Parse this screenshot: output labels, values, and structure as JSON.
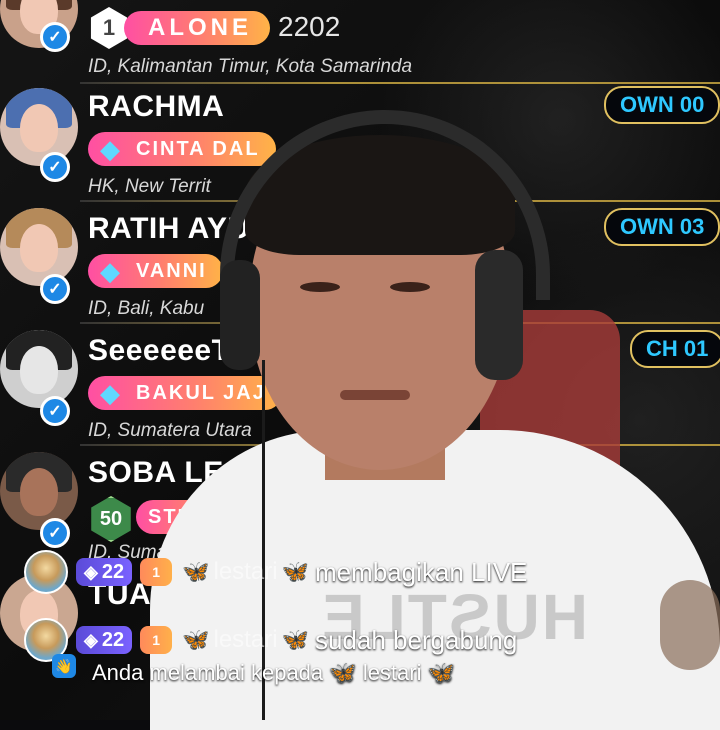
{
  "leaderboard": [
    {
      "rank": "1",
      "name": "ALONE",
      "score": "2202",
      "location": "ID, Kalimantan Timur, Kota Samarinda",
      "pill": ""
    },
    {
      "name": "RACHMA",
      "badge": "CINTA DAL",
      "location": "HK, New Territ",
      "pill": "OWN 00"
    },
    {
      "name": "RATIH AYU",
      "badge": "VANNI",
      "location": "ID, Bali, Kabu",
      "pill": "OWN 03"
    },
    {
      "name": "SeeeeeeT",
      "badge": "BAKUL JAJ",
      "location": "ID, Sumatera Utara",
      "pill": "CH 01"
    },
    {
      "name": "SOBA LESMA",
      "level": "50",
      "badge": "STEEL",
      "location": "ID, Suma"
    },
    {
      "name": "TUAN"
    }
  ],
  "chat": [
    {
      "level": "22",
      "fan_level": "1",
      "username": "lestari",
      "message": "membagikan LIVE"
    },
    {
      "level": "22",
      "fan_level": "1",
      "username": "lestari",
      "message": "sudah bergabung"
    }
  ],
  "wave_notice": {
    "text": "Anda melambai kepada",
    "username": "lestari"
  },
  "shirt_text": "HUSTLE",
  "icons": {
    "verified": "verified-check-icon",
    "diamond": "diamond-icon",
    "butterfly": "butterfly-icon"
  }
}
